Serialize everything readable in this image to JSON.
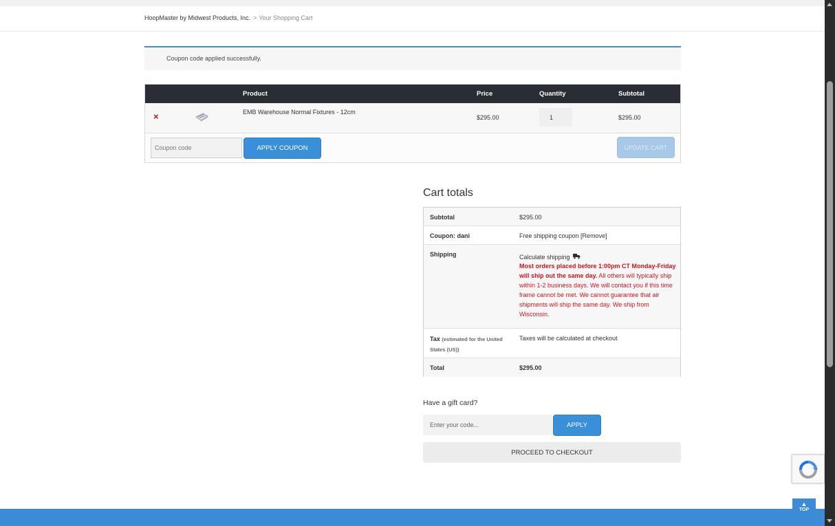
{
  "breadcrumb": {
    "home": "HoopMaster by Midwest Products, Inc.",
    "separator": ">",
    "current": "Your Shopping Cart"
  },
  "notice": {
    "message": "Coupon code applied successfully."
  },
  "cart": {
    "columns": {
      "product": "Product",
      "price": "Price",
      "quantity": "Quantity",
      "subtotal": "Subtotal"
    },
    "items": [
      {
        "remove_icon": "×",
        "name": "EMB Warehouse Normal Fixtures - 12cm",
        "price": "$295.00",
        "quantity": "1",
        "subtotal": "$295.00"
      }
    ],
    "coupon_placeholder": "Coupon code",
    "apply_coupon_label": "APPLY COUPON",
    "update_cart_label": "UPDATE CART"
  },
  "totals": {
    "title": "Cart totals",
    "subtotal_label": "Subtotal",
    "subtotal_value": "$295.00",
    "coupon_label": "Coupon: dani",
    "coupon_value": "Free shipping coupon [Remove]",
    "shipping_label": "Shipping",
    "calculate_shipping": "Calculate shipping",
    "shipping_notice_bold": "Most orders placed before 1:00pm CT Monday-Friday will ship out the same day.",
    "shipping_notice_rest": " All others will typically ship within 1-2 business days. We will contact you if this time frame cannot be met. We cannot guarantee that air shipments will ship the same day. We ship from Wisconsin.",
    "tax_label": "Tax",
    "tax_note": "(estimated for the United States (US))",
    "tax_value": "Taxes will be calculated at checkout",
    "total_label": "Total",
    "total_value": "$295.00"
  },
  "gift_card": {
    "label": "Have a gift card?",
    "placeholder": "Enter your code...",
    "apply_label": "APPLY"
  },
  "checkout_label": "PROCEED TO CHECKOUT",
  "back_to_top": {
    "arrow": "▲",
    "label": "TOP"
  },
  "colors": {
    "accent": "#3a8fd9",
    "header_dark": "#2a2d34",
    "alert_red": "#d0151c",
    "remove_red": "#c0141b"
  },
  "icons": [
    "remove-icon",
    "product-thumbnail",
    "truck-icon",
    "recaptcha-logo-icon",
    "chevron-up-icon"
  ]
}
